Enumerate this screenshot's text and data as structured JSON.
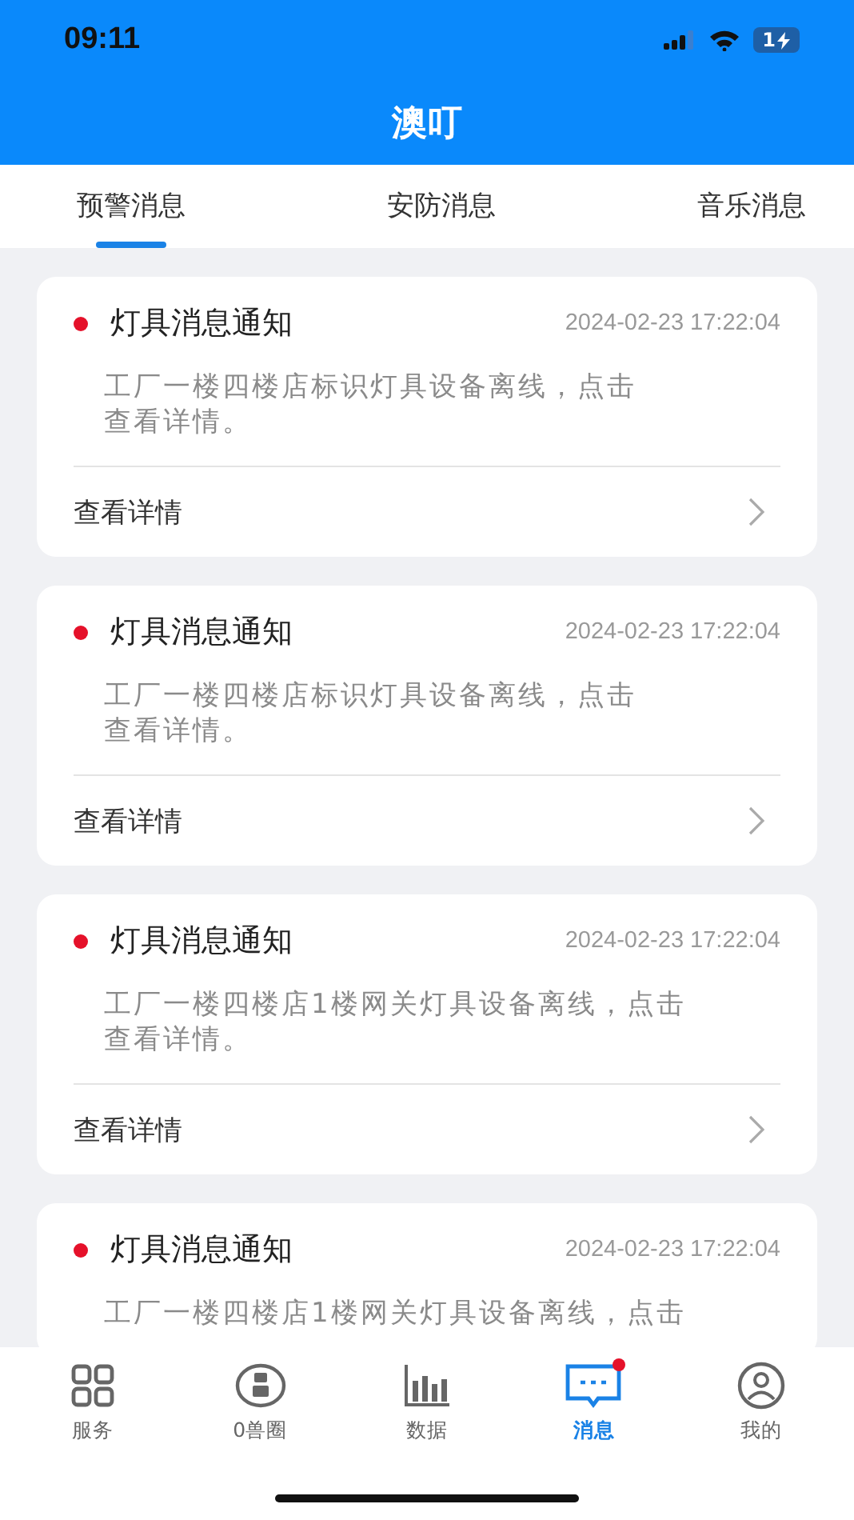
{
  "status_bar": {
    "time": "09:11",
    "battery": "1"
  },
  "header": {
    "title": "澳叮"
  },
  "tabs": [
    {
      "label": "预警消息",
      "selected": true
    },
    {
      "label": "安防消息",
      "selected": false
    },
    {
      "label": "音乐消息",
      "selected": false
    }
  ],
  "messages": [
    {
      "title": "灯具消息通知",
      "time": "2024-02-23 17:22:04",
      "unread": true,
      "description": [
        "工厂一楼四楼店标识灯具设备离线，点击",
        "查看详情。"
      ],
      "link": "查看详情"
    },
    {
      "title": "灯具消息通知",
      "time": "2024-02-23 17:22:04",
      "unread": true,
      "description": [
        "工厂一楼四楼店标识灯具设备离线，点击",
        "查看详情。"
      ],
      "link": "查看详情"
    },
    {
      "title": "灯具消息通知",
      "time": "2024-02-23 17:22:04",
      "unread": true,
      "description": [
        "工厂一楼四楼店1楼网关灯具设备离线，点击",
        "查看详情。"
      ],
      "link": "查看详情"
    },
    {
      "title": "灯具消息通知",
      "time": "2024-02-23 17:22:04",
      "unread": true,
      "description": [
        "工厂一楼四楼店1楼网关灯具设备离线，点击"
      ]
    }
  ],
  "bottom_nav": [
    {
      "kind": "grid",
      "label": "服务",
      "selected": false,
      "badge": false
    },
    {
      "kind": "circle",
      "label": "0兽圈",
      "selected": false,
      "badge": false
    },
    {
      "kind": "chart",
      "label": "数据",
      "selected": false,
      "badge": false
    },
    {
      "kind": "message",
      "label": "消息",
      "selected": true,
      "badge": true
    },
    {
      "kind": "user",
      "label": "我的",
      "selected": false,
      "badge": false
    }
  ]
}
